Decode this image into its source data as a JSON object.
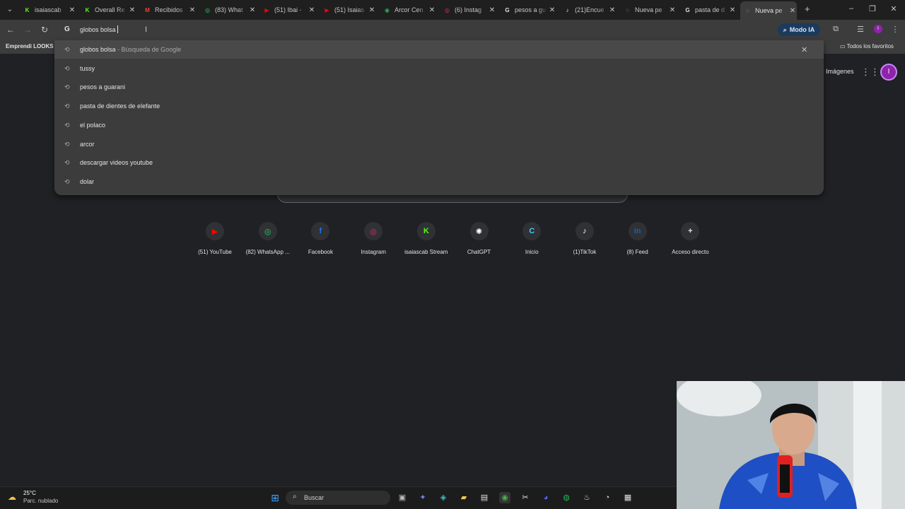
{
  "tabs": [
    {
      "title": "isaiascab",
      "favicon_color": "#53fc18",
      "favicon_letter": "K"
    },
    {
      "title": "Overall Re",
      "favicon_color": "#53fc18",
      "favicon_letter": "K"
    },
    {
      "title": "Recibidos",
      "favicon_color": "#ea4335",
      "favicon_letter": "M"
    },
    {
      "title": "(83) What",
      "favicon_color": "#25d366",
      "favicon_letter": "◎"
    },
    {
      "title": "(51) Ibai -",
      "favicon_color": "#ff0000",
      "favicon_letter": "▶"
    },
    {
      "title": "(51) Isaias",
      "favicon_color": "#ff0000",
      "favicon_letter": "▶"
    },
    {
      "title": "Arcor Cen",
      "favicon_color": "#34a853",
      "favicon_letter": "◉"
    },
    {
      "title": "(6) Instag",
      "favicon_color": "#e1306c",
      "favicon_letter": "◎"
    },
    {
      "title": "pesos a gu",
      "favicon_color": "#e3e3e3",
      "favicon_letter": "G"
    },
    {
      "title": "(21)Encue",
      "favicon_color": "#e3e3e3",
      "favicon_letter": "♪"
    },
    {
      "title": "Nueva pe",
      "favicon_color": "#c4c7c5",
      "favicon_letter": "◌"
    },
    {
      "title": "pasta de d",
      "favicon_color": "#e3e3e3",
      "favicon_letter": "G"
    },
    {
      "title": "Nueva pe",
      "favicon_color": "#c4c7c5",
      "favicon_letter": "◌"
    }
  ],
  "omnibox": {
    "value": "globos bolsa",
    "engine_icon": "G"
  },
  "modo_ia": {
    "label": "Modo IA"
  },
  "bookmarks": {
    "item": "Emprendi LOOKS N",
    "all_favorites": "Todos los favoritos"
  },
  "suggestions": [
    {
      "text": "globos bolsa",
      "sub": " - Búsqueda de Google",
      "highlighted": true
    },
    {
      "text": "tussy",
      "sub": ""
    },
    {
      "text": "pesos a guarani",
      "sub": ""
    },
    {
      "text": "pasta de dientes de elefante",
      "sub": ""
    },
    {
      "text": "el polaco",
      "sub": ""
    },
    {
      "text": "arcor",
      "sub": ""
    },
    {
      "text": "descargar videos youtube",
      "sub": ""
    },
    {
      "text": "dolar",
      "sub": ""
    }
  ],
  "ntp": {
    "images_link": "Imágenes",
    "avatar_letter": "I",
    "shortcuts": [
      {
        "label": "(51) YouTube",
        "icon": "▶",
        "color": "#ff0000"
      },
      {
        "label": "(82) WhatsApp ...",
        "icon": "◎",
        "color": "#25d366"
      },
      {
        "label": "Facebook",
        "icon": "f",
        "color": "#1877f2"
      },
      {
        "label": "Instagram",
        "icon": "◎",
        "color": "#e1306c"
      },
      {
        "label": "isaiascab Stream",
        "icon": "K",
        "color": "#53fc18"
      },
      {
        "label": "ChatGPT",
        "icon": "✺",
        "color": "#ffffff"
      },
      {
        "label": "Inicio",
        "icon": "C",
        "color": "#4fc3f7"
      },
      {
        "label": "(1)TikTok",
        "icon": "♪",
        "color": "#ffffff"
      },
      {
        "label": "(8) Feed",
        "icon": "in",
        "color": "#0a66c2"
      },
      {
        "label": "Acceso directo",
        "icon": "+",
        "color": "#e3e3e3"
      }
    ]
  },
  "taskbar": {
    "temperature": "25°C",
    "weather": "Parc. nublado",
    "search_label": "Buscar"
  }
}
